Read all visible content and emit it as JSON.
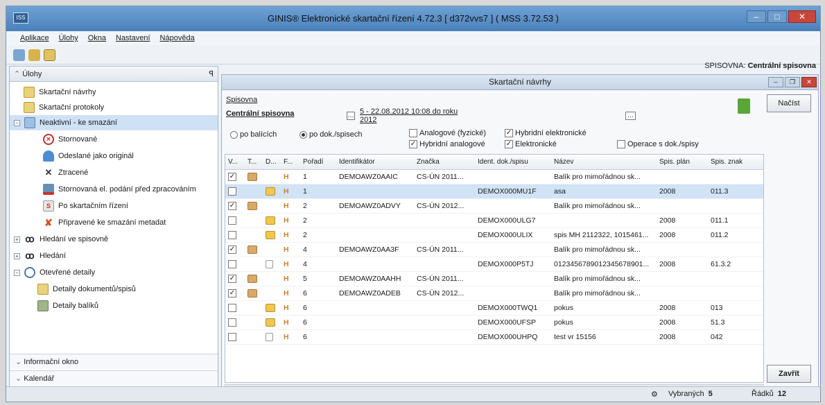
{
  "window": {
    "title": "GINIS® Elektronické skartační řízení 4.72.3 [ d372vvs7 ] ( MSS 3.72.53 )",
    "logo_text": "ISS"
  },
  "menu": [
    "Aplikace",
    "Úlohy",
    "Okna",
    "Nastavení",
    "Nápověda"
  ],
  "toolbar": {
    "spisovna_label": "SPISOVNA:",
    "spisovna_value": "Centrální spisovna"
  },
  "left": {
    "header": "Úlohy",
    "pin": "ꟼ",
    "items": [
      {
        "label": "Skartační návrhy",
        "icon": "document-icon"
      },
      {
        "label": "Skartační protokoly",
        "icon": "document-icon"
      },
      {
        "label": "Neaktivní - ke smazání",
        "icon": "folder-icon"
      },
      {
        "label": "Stornované",
        "icon": "cancel-icon"
      },
      {
        "label": "Odeslané jako originál",
        "icon": "upload-icon"
      },
      {
        "label": "Ztracené",
        "icon": "x-icon"
      },
      {
        "label": "Stornovaná el. podání před zpracováním",
        "icon": "inbox-icon"
      },
      {
        "label": "Po skartačním řízení",
        "icon": "document-icon"
      },
      {
        "label": "Připravené ke smazání metadat",
        "icon": "delete-icon"
      },
      {
        "label": "Hledání ve spisovně",
        "icon": "binoculars-icon"
      },
      {
        "label": "Hledání",
        "icon": "binoculars-icon"
      },
      {
        "label": "Otevřené detaily",
        "icon": "magnifier-icon"
      },
      {
        "label": "Detaily dokumentů/spisů",
        "icon": "document-icon"
      },
      {
        "label": "Detaily balíků",
        "icon": "package-icon"
      }
    ],
    "bottom": [
      "Informační okno",
      "Kalendář"
    ]
  },
  "main": {
    "title": "Skartační návrhy",
    "spisovna_link": "Spisovna",
    "spisovna_value": "Centrální spisovna",
    "date_range": "5 - 22.08.2012 10:08 do roku 2012",
    "date_btn": "...",
    "radio1": "po balících",
    "radio2": "po dok./spisech",
    "cb_analog": "Analogové (fyzické)",
    "cb_hybrid_el": "Hybridní elektronické",
    "cb_hybrid_an": "Hybridní analogové",
    "cb_elektro": "Elektronické",
    "cb_operace": "Operace s dok./spisy",
    "nacist": "Načíst",
    "zavrit": "Zavřít"
  },
  "grid": {
    "columns": [
      "V...",
      "T...",
      "D...",
      "F...",
      "Pořadí",
      "Identifikátor",
      "Značka",
      "Ident. dok./spisu",
      "Název",
      "Spis. plán",
      "Spis. znak"
    ],
    "rows": [
      {
        "check": true,
        "type": "package",
        "h": "H",
        "order": "1",
        "id": "DEMOAWZ0AAIC",
        "znacka": "CS-ÚN 2011...",
        "ident": "",
        "nazev": "Balík pro mimořádnou sk...",
        "plan": "",
        "znak": "",
        "sel": false
      },
      {
        "check": false,
        "type": "folder",
        "h": "H",
        "order": "1",
        "id": "",
        "znacka": "",
        "ident": "DEMOX000MU1F",
        "nazev": "asa",
        "plan": "2008",
        "znak": "011.3",
        "sel": true
      },
      {
        "check": true,
        "type": "package",
        "h": "H",
        "order": "2",
        "id": "DEMOAWZ0ADVY",
        "znacka": "CS-ÚN 2012...",
        "ident": "",
        "nazev": "Balík pro mimořádnou sk...",
        "plan": "",
        "znak": "",
        "sel": false
      },
      {
        "check": false,
        "type": "folder",
        "h": "H",
        "order": "2",
        "id": "",
        "znacka": "",
        "ident": "DEMOX000ULG7",
        "nazev": "",
        "plan": "2008",
        "znak": "011.1",
        "sel": false
      },
      {
        "check": false,
        "type": "folder",
        "h": "H",
        "order": "2",
        "id": "",
        "znacka": "",
        "ident": "DEMOX000ULIX",
        "nazev": "spis MH 2112322, 1015461...",
        "plan": "2008",
        "znak": "011.2",
        "sel": false
      },
      {
        "check": true,
        "type": "package",
        "h": "H",
        "order": "4",
        "id": "DEMOAWZ0AA3F",
        "znacka": "CS-ÚN 2011...",
        "ident": "",
        "nazev": "Balík pro mimořádnou sk...",
        "plan": "",
        "znak": "",
        "sel": false
      },
      {
        "check": false,
        "type": "doc",
        "h": "H",
        "order": "4",
        "id": "",
        "znacka": "",
        "ident": "DEMOX000P5TJ",
        "nazev": "0123456789012345678901...",
        "plan": "2008",
        "znak": "61.3.2",
        "sel": false
      },
      {
        "check": true,
        "type": "package",
        "h": "H",
        "order": "5",
        "id": "DEMOAWZ0AAHH",
        "znacka": "CS-ÚN 2011...",
        "ident": "",
        "nazev": "Balík pro mimořádnou sk...",
        "plan": "",
        "znak": "",
        "sel": false
      },
      {
        "check": true,
        "type": "package",
        "h": "H",
        "order": "6",
        "id": "DEMOAWZ0ADEB",
        "znacka": "CS-ÚN 2012...",
        "ident": "",
        "nazev": "Balík pro mimořádnou sk...",
        "plan": "",
        "znak": "",
        "sel": false
      },
      {
        "check": false,
        "type": "folder",
        "h": "H",
        "order": "6",
        "id": "",
        "znacka": "",
        "ident": "DEMOX000TWQ1",
        "nazev": "pokus",
        "plan": "2008",
        "znak": "013",
        "sel": false
      },
      {
        "check": false,
        "type": "folder",
        "h": "H",
        "order": "6",
        "id": "",
        "znacka": "",
        "ident": "DEMOX000UFSP",
        "nazev": "pokus",
        "plan": "2008",
        "znak": "51.3",
        "sel": false
      },
      {
        "check": false,
        "type": "doc",
        "h": "H",
        "order": "6",
        "id": "",
        "znacka": "",
        "ident": "DEMOX000UHPQ",
        "nazev": "test vr 15156",
        "plan": "2008",
        "znak": "042",
        "sel": false
      }
    ]
  },
  "status": {
    "vybranych_label": "Vybraných",
    "vybranych": "5",
    "radku_label": "Řádků",
    "radku": "12"
  },
  "colors": {
    "title": "#4a80bb",
    "selection": "#d2e3f6",
    "h_mark": "#e07a1a"
  }
}
